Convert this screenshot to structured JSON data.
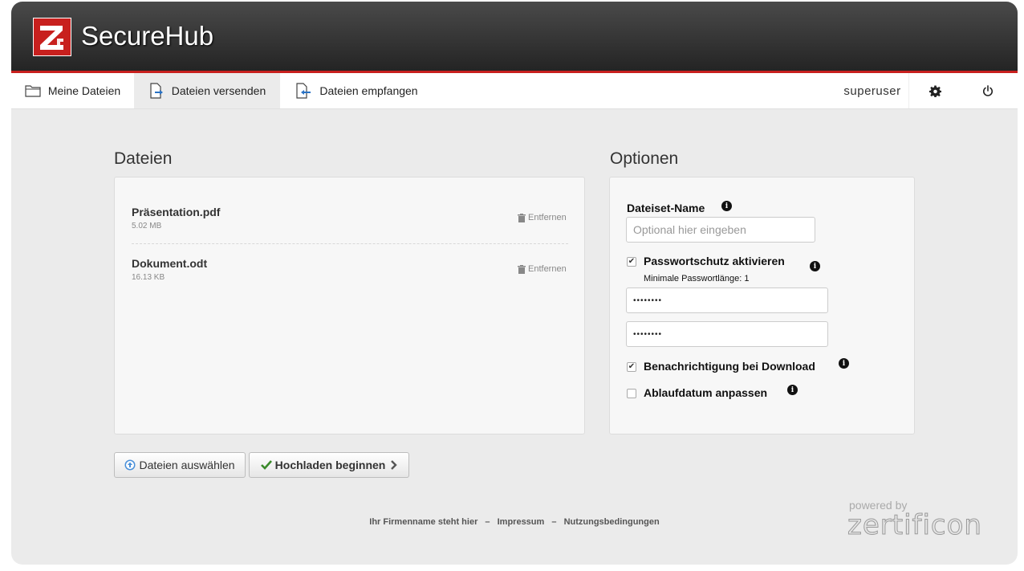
{
  "app": {
    "brand": "SecureHub"
  },
  "nav": {
    "tabs": [
      {
        "label": "Meine Dateien",
        "icon": "folder-icon"
      },
      {
        "label": "Dateien versenden",
        "icon": "send-file-icon",
        "active": true
      },
      {
        "label": "Dateien empfangen",
        "icon": "receive-file-icon"
      }
    ],
    "user": "superuser"
  },
  "files": {
    "title": "Dateien",
    "items": [
      {
        "name": "Präsentation.pdf",
        "size": "5.02 MB",
        "remove": "Entfernen"
      },
      {
        "name": "Dokument.odt",
        "size": "16.13 KB",
        "remove": "Entfernen"
      }
    ]
  },
  "options": {
    "title": "Optionen",
    "dataset_label": "Dateiset-Name",
    "dataset_placeholder": "Optional hier eingeben",
    "password_label": "Passwortschutz aktivieren",
    "password_checked": true,
    "password_hint": "Minimale Passwortlänge: 1",
    "password_value": "••••••••",
    "password_confirm_value": "••••••••",
    "notify_label": "Benachrichtigung bei Download",
    "notify_checked": true,
    "expiry_label": "Ablaufdatum anpassen",
    "expiry_checked": false
  },
  "buttons": {
    "select": "Dateien auswählen",
    "upload": "Hochladen beginnen"
  },
  "footer": {
    "company": "Ihr Firmenname steht hier",
    "separator": "–",
    "imprint": "Impressum",
    "terms": "Nutzungsbedingungen",
    "powered_by": "powered by",
    "vendor": "zertificon"
  },
  "colors": {
    "brand_red": "#c8201e",
    "check_green": "#3a8a2a",
    "info_blue": "#4a90d9"
  }
}
